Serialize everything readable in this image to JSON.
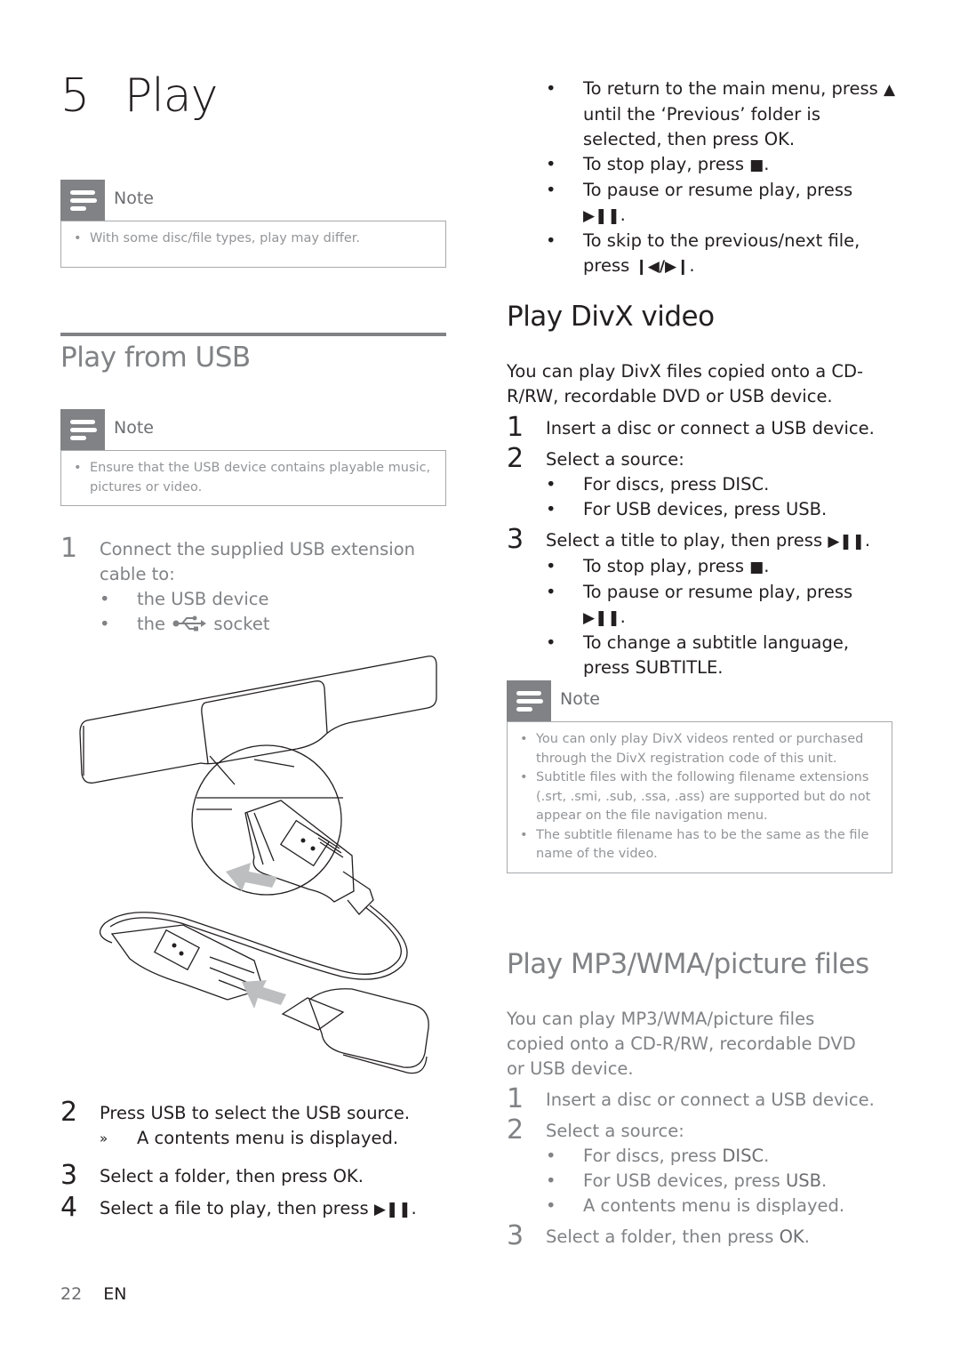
{
  "chapter": {
    "number": "5",
    "title": "Play"
  },
  "intro_note": {
    "label": "Note",
    "items": [
      "With some disc/file types, play may differ."
    ]
  },
  "usb_section": {
    "title": "Play from USB",
    "note": {
      "label": "Note",
      "items": [
        "Ensure that the USB device contains playable music, pictures or video."
      ]
    },
    "step1": {
      "number": "1",
      "text": "Connect the supplied USB extension cable to:",
      "bullets": {
        "b1": "the USB device",
        "b2_pre": "the",
        "b2_post": "socket"
      }
    },
    "step2": {
      "number": "2",
      "pre": "Press",
      "key": "USB",
      "post": "to select the USB source.",
      "result_marker": "»",
      "result": "A contents menu is displayed."
    },
    "step3": {
      "number": "3",
      "pre": "Select a folder, then press",
      "key": "OK",
      "post": "."
    },
    "step4": {
      "number": "4",
      "pre": "Select a file to play, then press",
      "key": "▶❚❚",
      "post": "."
    },
    "illustration_alt": "USB extension cable connecting USB device to the unit's USB socket"
  },
  "right_top_bullets": {
    "b1_pre": "To return to the main menu, press",
    "b1_key": "▲",
    "b1_mid": "until the ‘Previous’ folder is selected, then press",
    "b1_key2": "OK",
    "b1_post": ".",
    "b2_pre": "To stop play, press",
    "b2_key": "■",
    "b2_post": ".",
    "b3_pre": "To pause or resume play, press",
    "b3_key": "▶❚❚",
    "b3_post": ".",
    "b4_pre": "To skip to the previous/next file, press",
    "b4_key": "❙◀/▶❙",
    "b4_post": "."
  },
  "divx_section": {
    "title": "Play DivX video",
    "intro": "You can play DivX files copied onto a CD-R/RW, recordable DVD or USB device.",
    "step1": {
      "number": "1",
      "text": "Insert a disc or connect a USB device."
    },
    "step2": {
      "number": "2",
      "text": "Select a source:",
      "b1_pre": "For discs, press",
      "b1_key": "DISC",
      "b1_post": ".",
      "b2_pre": "For USB devices, press",
      "b2_key": "USB",
      "b2_post": "."
    },
    "step3": {
      "number": "3",
      "pre": "Select a title to play, then press",
      "key": "▶❚❚",
      "post": ".",
      "b1_pre": "To stop play, press",
      "b1_key": "■",
      "b1_post": ".",
      "b2_pre": "To pause or resume play, press",
      "b2_key": "▶❚❚",
      "b2_post": ".",
      "b3_pre": "To change a subtitle language, press",
      "b3_key": "SUBTITLE",
      "b3_post": "."
    },
    "note": {
      "label": "Note",
      "items": [
        "You can only play DivX videos rented or purchased through the DivX registration code of this unit.",
        "Subtitle files with the following filename extensions (.srt, .smi, .sub, .ssa, .ass) are supported but do not appear on the file navigation menu.",
        "The subtitle filename has to be the same as the file name of the video."
      ]
    }
  },
  "mp3_section": {
    "title": "Play MP3/WMA/picture files",
    "intro": "You can play MP3/WMA/picture files copied onto a CD-R/RW, recordable DVD or USB device.",
    "step1": {
      "number": "1",
      "text": "Insert a disc or connect a USB device."
    },
    "step2": {
      "number": "2",
      "text": "Select a source:",
      "b1_pre": "For discs, press",
      "b1_key": "DISC",
      "b1_post": ".",
      "b2_pre": "For USB devices, press",
      "b2_key": "USB",
      "b2_post": ".",
      "b3": "A contents menu is displayed."
    },
    "step3": {
      "number": "3",
      "pre": "Select a folder, then press",
      "key": "OK",
      "post": "."
    }
  },
  "footer": {
    "page": "22",
    "lang": "EN"
  },
  "colors": {
    "text": "#231f20",
    "grey_text": "#808285",
    "note_icon_bg": "#808285",
    "note_border": "#a7a9ac",
    "arrow": "#bcbec0"
  }
}
